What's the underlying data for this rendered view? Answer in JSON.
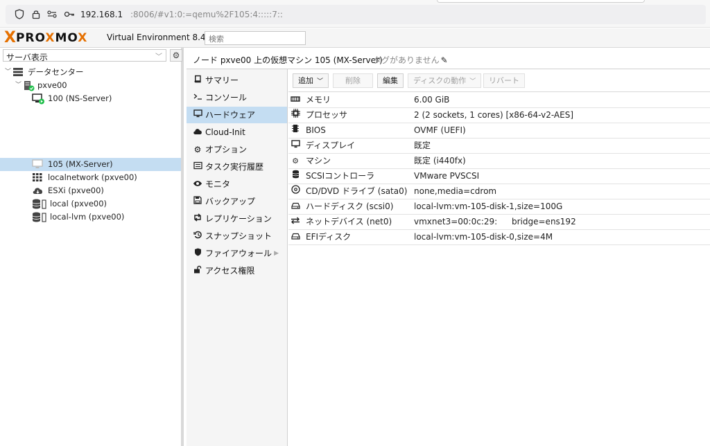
{
  "browser": {
    "url_host": "192.168.1",
    "url_path": ":8006/#v1:0:=qemu%2F105:4:::::7::"
  },
  "header": {
    "logo_x": "X",
    "logo_pro": "PRO",
    "logo_x2": "X",
    "logo_m": "M",
    "logo_o": "O",
    "version": "Virtual Environment 8.4.1",
    "search_placeholder": "検索"
  },
  "sidebar": {
    "view_select": "サーバ表示",
    "tree": [
      {
        "label": "データセンター"
      },
      {
        "label": "pxve00"
      },
      {
        "label": "100 (NS-Server)"
      },
      {
        "label": "105 (MX-Server)"
      },
      {
        "label": "localnetwork (pxve00)"
      },
      {
        "label": "ESXi (pxve00)"
      },
      {
        "label": "local (pxve00)"
      },
      {
        "label": "local-lvm (pxve00)"
      }
    ]
  },
  "content": {
    "title": "ノード pxve00 上の仮想マシン 105 (MX-Server)",
    "tags": "タグがありません"
  },
  "menu": {
    "items": [
      {
        "label": "サマリー",
        "icon": "book-icon"
      },
      {
        "label": "コンソール",
        "icon": "terminal-icon"
      },
      {
        "label": "ハードウェア",
        "icon": "desktop-icon"
      },
      {
        "label": "Cloud-Init",
        "icon": "cloud-icon"
      },
      {
        "label": "オプション",
        "icon": "gear-icon"
      },
      {
        "label": "タスク実行履歴",
        "icon": "list-icon"
      },
      {
        "label": "モニタ",
        "icon": "eye-icon"
      },
      {
        "label": "バックアップ",
        "icon": "floppy-icon"
      },
      {
        "label": "レプリケーション",
        "icon": "retweet-icon"
      },
      {
        "label": "スナップショット",
        "icon": "history-icon"
      },
      {
        "label": "ファイアウォール",
        "icon": "shield-icon"
      },
      {
        "label": "アクセス権限",
        "icon": "unlock-icon"
      }
    ]
  },
  "toolbar": {
    "add": "追加",
    "remove": "削除",
    "edit": "編集",
    "disk_action": "ディスクの動作",
    "revert": "リバート"
  },
  "hardware": [
    {
      "key": "メモリ",
      "value": "6.00 GiB",
      "icon": "memory-icon"
    },
    {
      "key": "プロセッサ",
      "value": "2 (2 sockets, 1 cores) [x86-64-v2-AES]",
      "icon": "cpu-icon"
    },
    {
      "key": "BIOS",
      "value": "OVMF (UEFI)",
      "icon": "microchip-icon"
    },
    {
      "key": "ディスプレイ",
      "value": "既定",
      "icon": "desktop-icon"
    },
    {
      "key": "マシン",
      "value": "既定 (i440fx)",
      "icon": "cogs-icon"
    },
    {
      "key": "SCSIコントローラ",
      "value": "VMware PVSCSI",
      "icon": "database-icon"
    },
    {
      "key": "CD/DVD ドライブ (sata0)",
      "value": "none,media=cdrom",
      "icon": "cdrom-icon"
    },
    {
      "key": "ハードディスク (scsi0)",
      "value": "local-lvm:vm-105-disk-1,size=100G",
      "icon": "hdd-icon"
    },
    {
      "key": "ネットデバイス (net0)",
      "value": "vmxnet3=00:0c:29:",
      "value2": "bridge=ens192",
      "icon": "exchange-icon"
    },
    {
      "key": "EFIディスク",
      "value": "local-lvm:vm-105-disk-0,size=4M",
      "icon": "hdd-icon"
    }
  ]
}
